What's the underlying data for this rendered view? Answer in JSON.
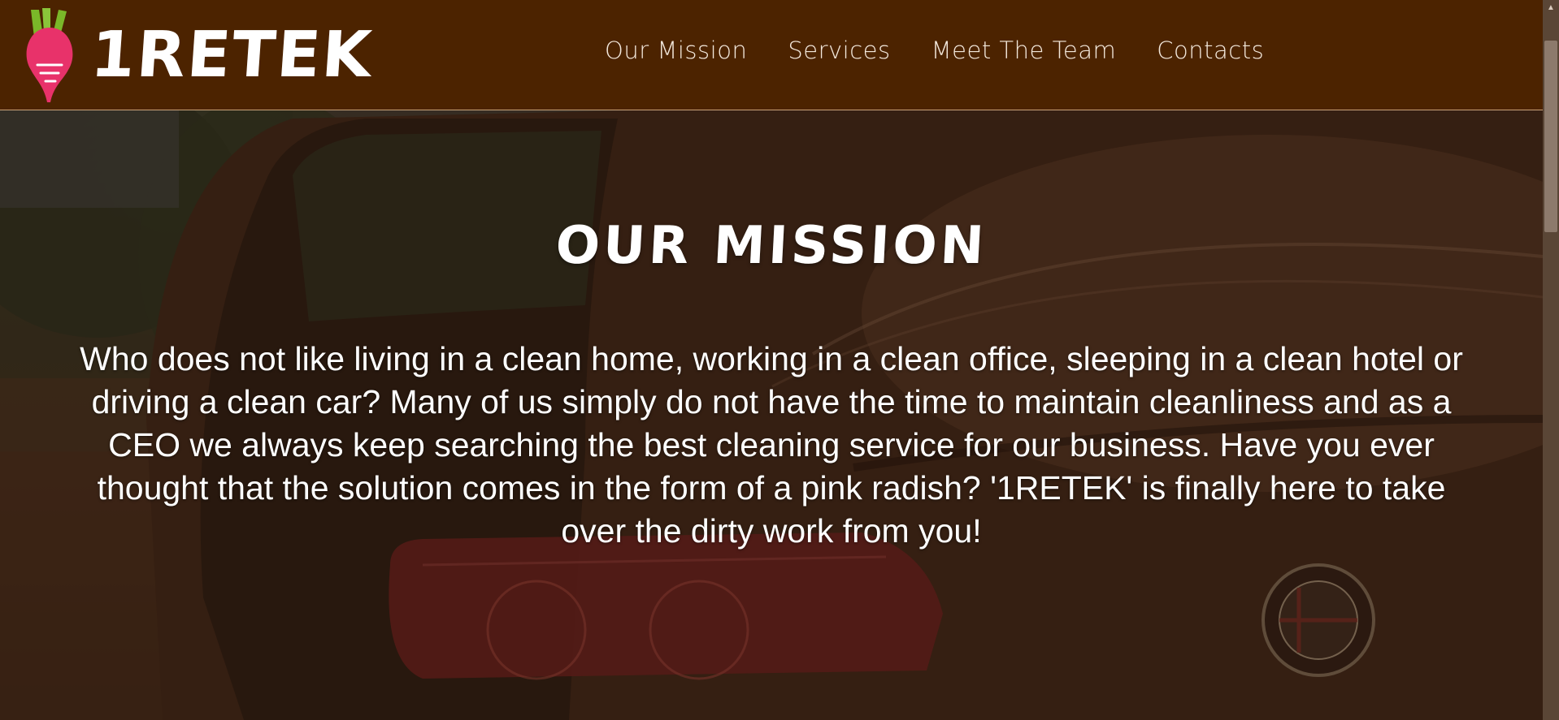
{
  "header": {
    "logo_text": "1RETEK",
    "nav": [
      {
        "label": "Our Mission"
      },
      {
        "label": "Services"
      },
      {
        "label": "Meet The Team"
      },
      {
        "label": "Contacts"
      }
    ]
  },
  "hero": {
    "title": "OUR MISSION",
    "body": "Who does not like living in a clean home, working in a clean office, sleeping in a clean hotel or driving a clean car? Many of us simply do not have the time to maintain cleanliness and as a CEO we always keep searching the best cleaning service for our business. Have you ever thought that the solution comes in the form of a pink radish? '1RETEK' is finally here to take over the dirty work from you!"
  },
  "icons": {
    "logo": "radish-icon",
    "scroll_up": "chevron-up-icon"
  },
  "colors": {
    "header_bg": "#4c2300",
    "radish_pink": "#e8326a",
    "leaf_green": "#7ab829",
    "text": "#ffffff"
  }
}
